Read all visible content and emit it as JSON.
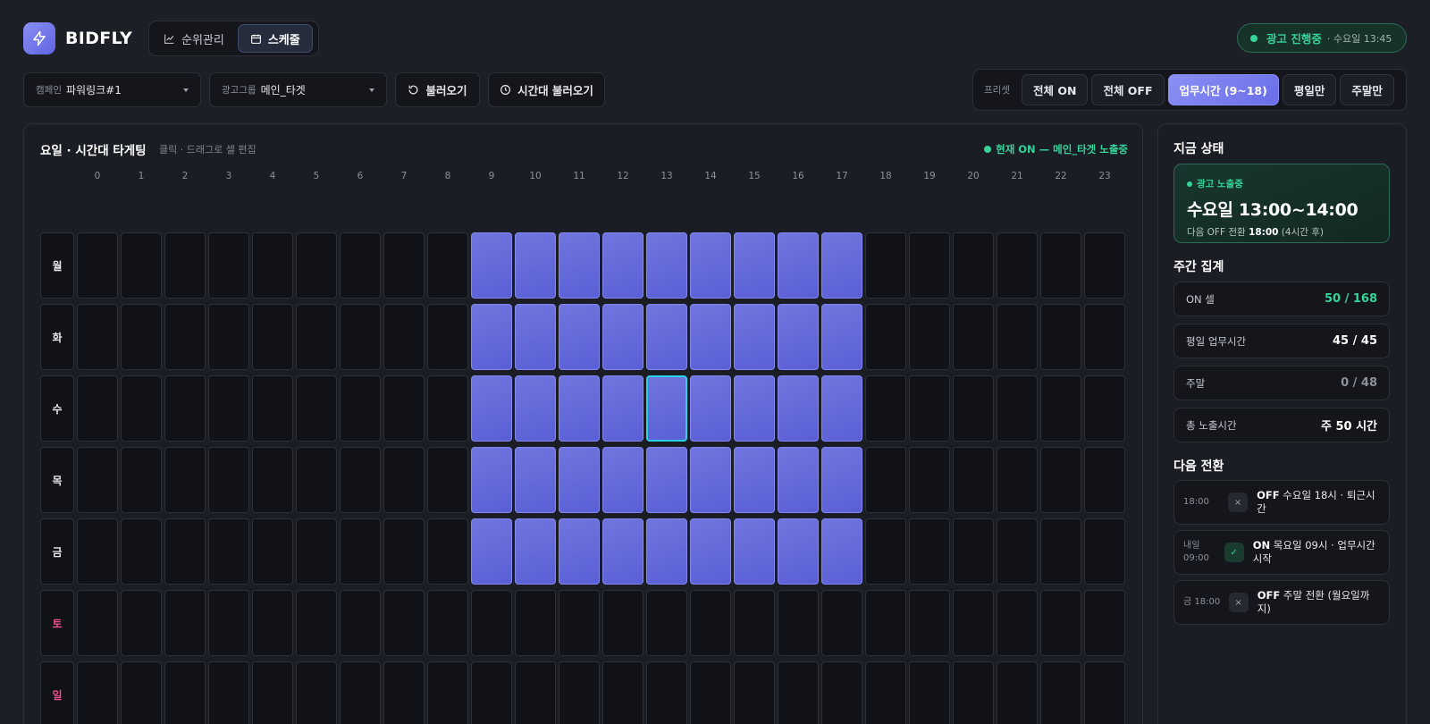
{
  "brand": {
    "name": "BIDFLY"
  },
  "nav": {
    "tabs": [
      {
        "label": "순위관리",
        "icon": "chart-line-icon"
      },
      {
        "label": "스케줄",
        "icon": "calendar-icon",
        "active": true
      }
    ]
  },
  "status_pill": {
    "main": "광고 진행중",
    "sub": "· 수요일 13:45"
  },
  "toolbar": {
    "campaign": {
      "label": "캠페인",
      "value": "파워링크#1"
    },
    "adgroup": {
      "label": "광고그룹",
      "value": "메인_타겟"
    },
    "load_label": "불러오기",
    "load_time_label": "시간대 불러오기",
    "preset_label": "프리셋",
    "presets": [
      "전체 ON",
      "전체 OFF",
      "업무시간 (9~18)",
      "평일만",
      "주말만"
    ],
    "active_preset": 2
  },
  "grid": {
    "title": "요일 · 시간대 타게팅",
    "hint": "클릭 · 드래그로 셀 편집",
    "status": "현재 ON — 메인_타겟 노출중",
    "hours": [
      "0",
      "1",
      "2",
      "3",
      "4",
      "5",
      "6",
      "7",
      "8",
      "9",
      "10",
      "11",
      "12",
      "13",
      "14",
      "15",
      "16",
      "17",
      "18",
      "19",
      "20",
      "21",
      "22",
      "23"
    ],
    "days": [
      "월",
      "화",
      "수",
      "목",
      "금",
      "토",
      "일"
    ],
    "weekend_days": [
      5,
      6
    ],
    "on_hours": [
      9,
      17
    ],
    "on_days": [
      0,
      1,
      2,
      3,
      4
    ],
    "current": {
      "day": 2,
      "hour": 13
    }
  },
  "sidebar": {
    "now_title": "지금 상태",
    "now_badge": "광고 노출중",
    "now_time": "수요일 13:00~14:00",
    "now_next_prefix": "다음 OFF 전환",
    "now_next_time": "18:00",
    "now_next_suffix": "(4시간 후)",
    "weekly_title": "주간 집계",
    "stats": [
      {
        "key": "ON 셀",
        "value": "50 / 168",
        "tone": "green"
      },
      {
        "key": "평일 업무시간",
        "value": "45 / 45",
        "tone": "white"
      },
      {
        "key": "주말",
        "value": "0 / 48",
        "tone": "muted"
      },
      {
        "key": "총 노출시간",
        "value": "주 50 시간",
        "tone": "white"
      }
    ],
    "next_title": "다음 전환",
    "transitions": [
      {
        "when": "18:00",
        "state": "OFF",
        "text": "수요일 18시 · 퇴근시간",
        "icon": "close-icon"
      },
      {
        "when": "내일 09:00",
        "state": "ON",
        "text": "목요일 09시 · 업무시간 시작",
        "icon": "check-icon"
      },
      {
        "when": "금 18:00",
        "state": "OFF",
        "text": "주말 전환 (월요일까지)",
        "icon": "close-icon"
      }
    ]
  },
  "colors": {
    "accent": "#6a6ee8",
    "on_cell": "#6468dc",
    "green": "#34d399",
    "current": "#29d3e6",
    "weekend": "#ec4f8e"
  }
}
